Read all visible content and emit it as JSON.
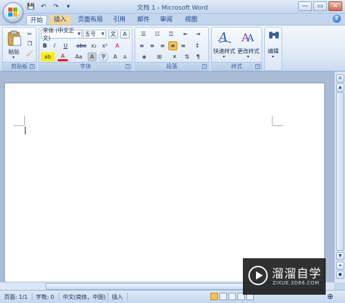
{
  "titlebar": {
    "title": "文档 1 - Microsoft Word",
    "qat": [
      "💾",
      "↶",
      "↷",
      "▾"
    ],
    "controls": [
      "—",
      "▭",
      "✕"
    ]
  },
  "tabs": [
    "开始",
    "插入",
    "页面布局",
    "引用",
    "邮件",
    "审阅",
    "视图"
  ],
  "ribbon": {
    "clipboard": {
      "label": "剪贴板",
      "paste": "粘贴"
    },
    "font": {
      "label": "字体",
      "font_name": "宋体 (中文正文)",
      "font_size": "五号",
      "bold": "B",
      "italic": "I",
      "underline": "U",
      "strike": "abe",
      "subscript": "x₂",
      "superscript": "x²",
      "clear": "A",
      "highlight": "ab",
      "font_color": "A",
      "change_case": "Aa",
      "char_shade": "A",
      "enclose": "字",
      "grow": "A",
      "shrink": "A",
      "phonetic": "文",
      "border": "A"
    },
    "paragraph": {
      "label": "段落"
    },
    "styles": {
      "label": "样式",
      "quick_styles": "快速样式",
      "change_styles": "更改样式"
    },
    "editing": {
      "label": "编辑",
      "edit": "编辑"
    }
  },
  "statusbar": {
    "page": "页面: 1/1",
    "words": "字数: 0",
    "language": "中文(简体，中国)",
    "mode": "插入"
  },
  "watermark": {
    "name": "溜溜自学",
    "url": "ZIXUE.3D66.COM"
  },
  "colors": {
    "accent": "#15428b",
    "ribbon_bg": "#dde8f6",
    "highlight": "#f6c25a"
  }
}
